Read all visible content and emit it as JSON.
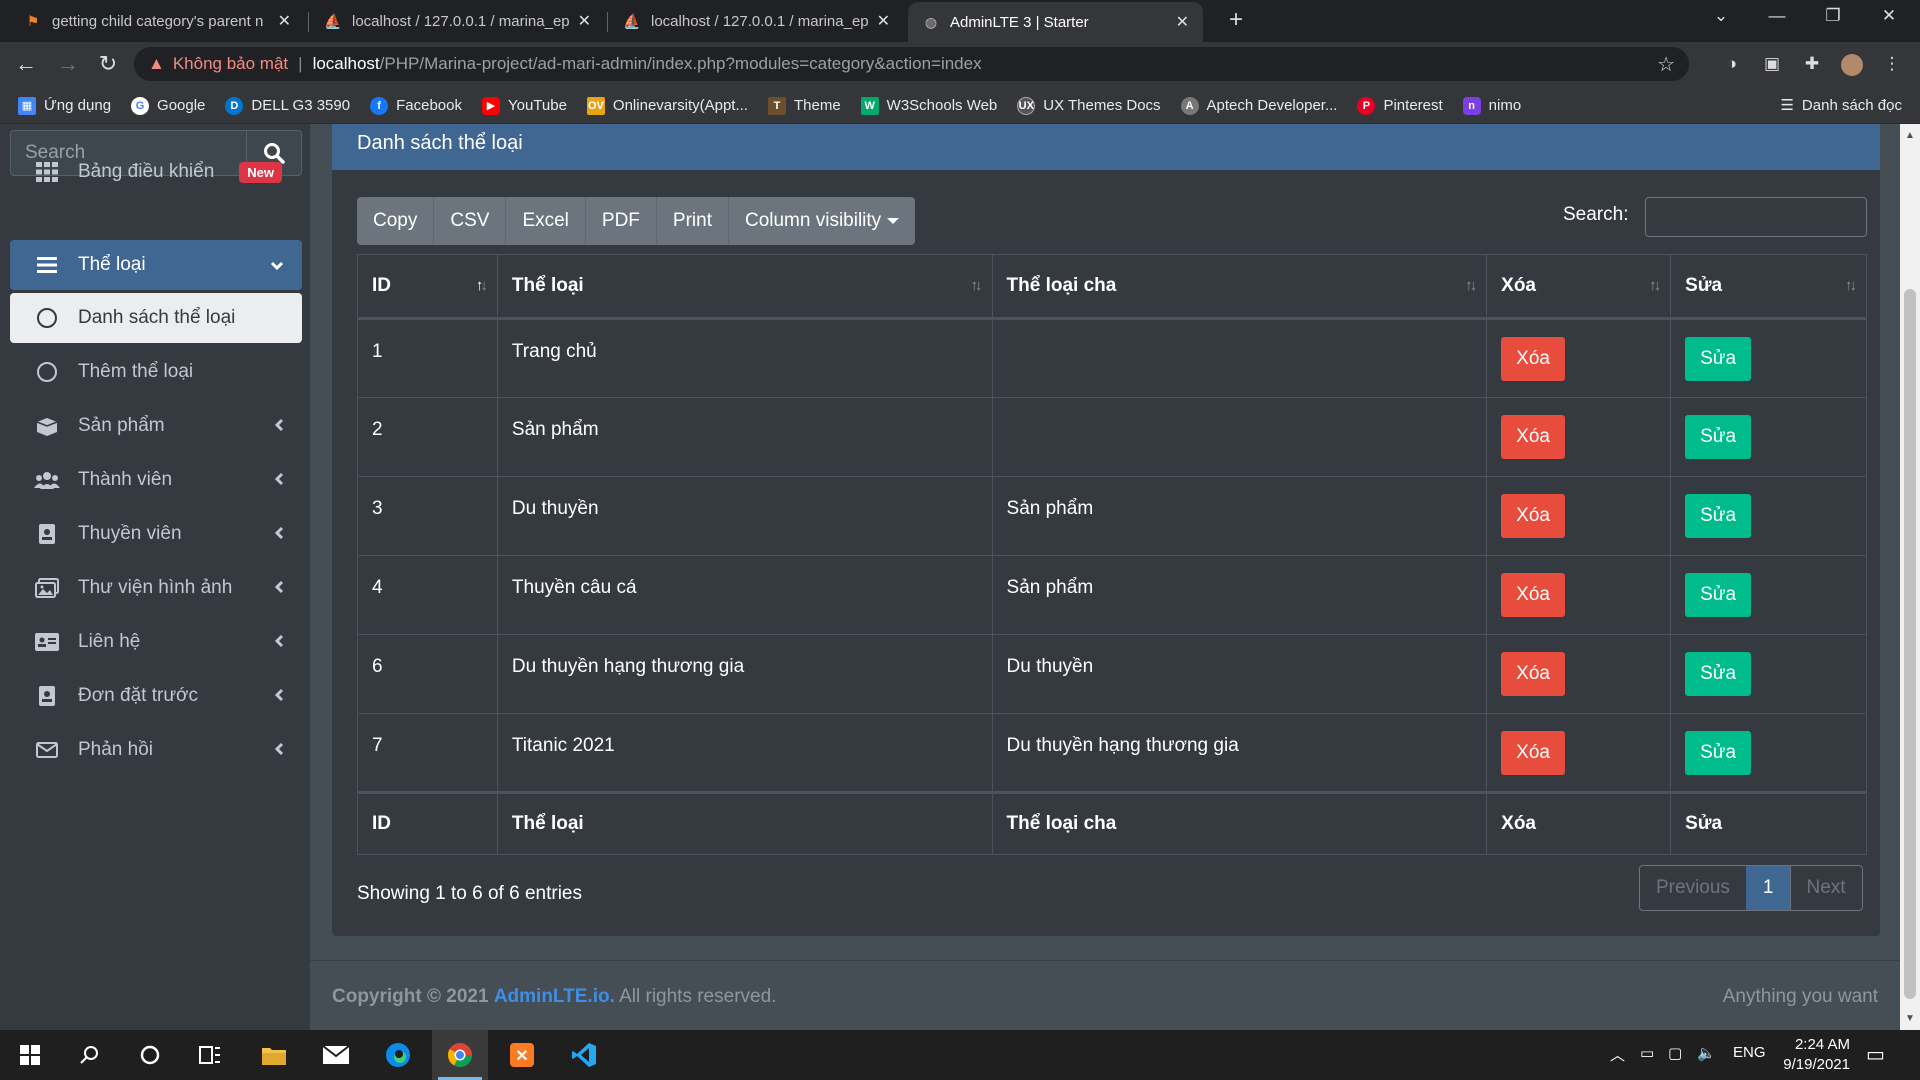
{
  "browser": {
    "tabs": [
      {
        "title": "getting child category's parent n",
        "active": false
      },
      {
        "title": "localhost / 127.0.0.1 / marina_ep",
        "active": false
      },
      {
        "title": "localhost / 127.0.0.1 / marina_ep",
        "active": false
      },
      {
        "title": "AdminLTE 3 | Starter",
        "active": true
      }
    ],
    "address": {
      "security_label": "Không bảo mật",
      "host": "localhost",
      "path": "/PHP/Marina-project/ad-mari-admin/index.php?modules=category&action=index"
    },
    "bookmarks": [
      {
        "label": "Ứng dụng",
        "color": "#4285f4"
      },
      {
        "label": "Google",
        "color": "#4285f4"
      },
      {
        "label": "DELL G3 3590",
        "color": "#0076ce"
      },
      {
        "label": "Facebook",
        "color": "#1877f2"
      },
      {
        "label": "YouTube",
        "color": "#ff0000"
      },
      {
        "label": "Onlinevarsity(Appt...",
        "color": "#e8a317"
      },
      {
        "label": "Theme",
        "color": "#6b4f2a"
      },
      {
        "label": "W3Schools Web",
        "color": "#04aa6d"
      },
      {
        "label": "UX Themes Docs",
        "color": "#555"
      },
      {
        "label": "Aptech Developer...",
        "color": "#777"
      },
      {
        "label": "Pinterest",
        "color": "#e60023"
      },
      {
        "label": "nimo",
        "color": "#7b3fe4"
      }
    ],
    "reading_list": "Danh sách đọc"
  },
  "sidebar": {
    "search_placeholder": "Search",
    "dashboard": {
      "label": "Bảng điều khiển",
      "badge": "New"
    },
    "category": {
      "label": "Thể loại"
    },
    "sub_list": "Danh sách thể loại",
    "sub_add": "Thêm thể loại",
    "items": [
      {
        "label": "Sản phẩm",
        "icon": "box-icon"
      },
      {
        "label": "Thành viên",
        "icon": "users-icon"
      },
      {
        "label": "Thuyền viên",
        "icon": "id-badge-icon"
      },
      {
        "label": "Thư viện hình ảnh",
        "icon": "images-icon"
      },
      {
        "label": "Liên hệ",
        "icon": "address-card-icon"
      },
      {
        "label": "Đơn đặt trước",
        "icon": "id-badge-icon"
      },
      {
        "label": "Phản hồi",
        "icon": "envelope-icon"
      }
    ]
  },
  "card": {
    "title": "Danh sách thể loại",
    "buttons": [
      "Copy",
      "CSV",
      "Excel",
      "PDF",
      "Print",
      "Column visibility"
    ],
    "search_label": "Search:",
    "columns": [
      "ID",
      "Thể loại",
      "Thể loại cha",
      "Xóa",
      "Sửa"
    ],
    "rows": [
      {
        "id": "1",
        "name": "Trang chủ",
        "parent": "",
        "del": "Xóa",
        "edit": "Sửa"
      },
      {
        "id": "2",
        "name": "Sản phẩm",
        "parent": "",
        "del": "Xóa",
        "edit": "Sửa"
      },
      {
        "id": "3",
        "name": "Du thuyền",
        "parent": "Sản phẩm",
        "del": "Xóa",
        "edit": "Sửa"
      },
      {
        "id": "4",
        "name": "Thuyền câu cá",
        "parent": "Sản phẩm",
        "del": "Xóa",
        "edit": "Sửa"
      },
      {
        "id": "6",
        "name": "Du thuyền hạng thương gia",
        "parent": "Du thuyền",
        "del": "Xóa",
        "edit": "Sửa"
      },
      {
        "id": "7",
        "name": "Titanic 2021",
        "parent": "Du thuyền hạng thương gia",
        "del": "Xóa",
        "edit": "Sửa"
      }
    ],
    "showing": "Showing 1 to 6 of 6 entries",
    "pager": {
      "prev": "Previous",
      "page": "1",
      "next": "Next"
    }
  },
  "footer": {
    "copyright_prefix": "Copyright © 2021",
    "brand": "AdminLTE.io.",
    "suffix": "All rights reserved.",
    "right": "Anything you want"
  },
  "taskbar": {
    "lang": "ENG",
    "time": "2:24 AM",
    "date": "9/19/2021"
  },
  "colors": {
    "primary": "#3f6791",
    "danger": "#e74c3c",
    "success": "#00bc8c",
    "sidebar": "#343a40",
    "content": "#454d55"
  }
}
